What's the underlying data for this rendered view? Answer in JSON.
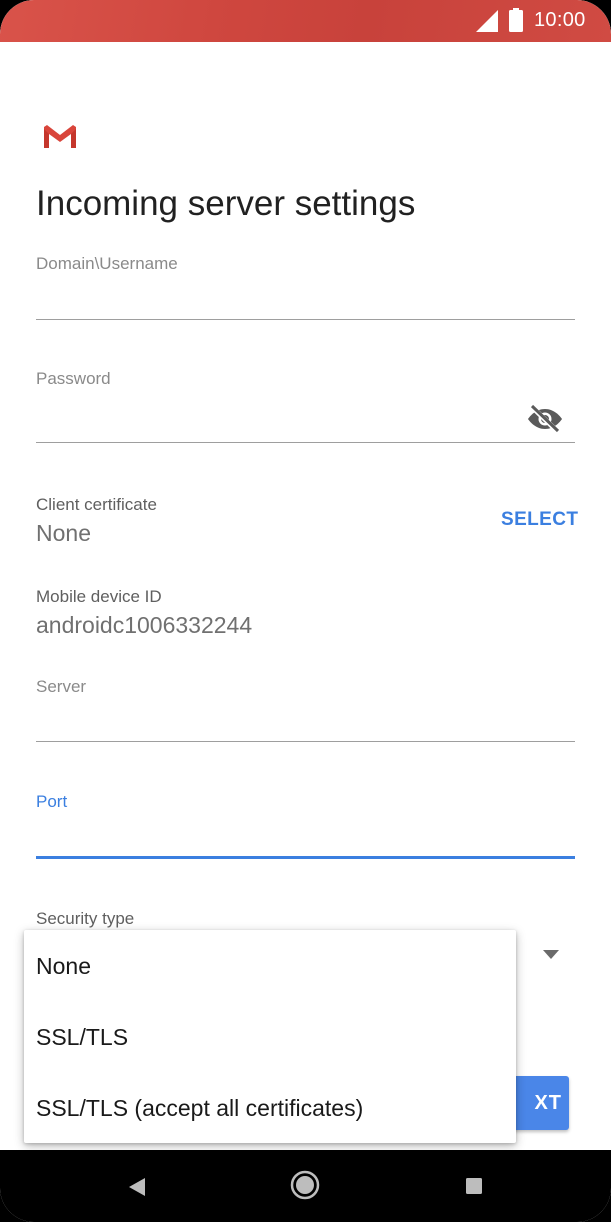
{
  "status_bar": {
    "time": "10:00",
    "color": "#cf473f",
    "icons": [
      "signal-icon",
      "battery-icon"
    ]
  },
  "app": {
    "logo": "gmail-logo",
    "title": "Incoming server settings"
  },
  "form": {
    "domain_username": {
      "label": "Domain\\Username",
      "value": ""
    },
    "password": {
      "label": "Password",
      "value": "",
      "toggle_icon": "visibility-off-icon"
    },
    "client_certificate": {
      "label": "Client certificate",
      "value": "None",
      "action": "SELECT"
    },
    "mobile_device_id": {
      "label": "Mobile device ID",
      "value": "androidc1006332244"
    },
    "server": {
      "label": "Server",
      "value": ""
    },
    "port": {
      "label": "Port",
      "value": "",
      "focused": true
    },
    "security_type": {
      "label": "Security type",
      "selected": "None"
    }
  },
  "next_button": {
    "label_visible": "XT"
  },
  "security_menu": {
    "options": [
      "None",
      "SSL/TLS",
      "SSL/TLS (accept all certificates)"
    ]
  },
  "colors": {
    "accent": "#3b7fe0",
    "button": "#4a86e8",
    "status_bar": "#cf473f"
  },
  "nav_bar": {
    "icons": [
      "back-icon",
      "home-icon",
      "recents-icon"
    ]
  }
}
